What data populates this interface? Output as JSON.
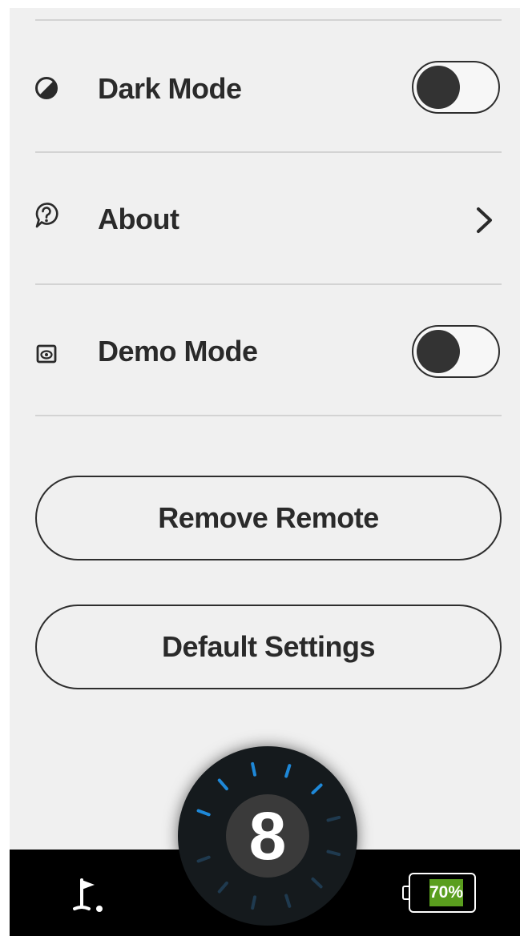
{
  "settings": {
    "rows": [
      {
        "label": "Dark Mode",
        "icon": "contrast-icon",
        "control": "toggle",
        "on": false
      },
      {
        "label": "About",
        "icon": "question-bubble-icon",
        "control": "chevron"
      },
      {
        "label": "Demo Mode",
        "icon": "eye-card-icon",
        "control": "toggle",
        "on": false
      }
    ],
    "buttons": {
      "remove_remote": "Remove Remote",
      "default_settings": "Default Settings"
    }
  },
  "dial": {
    "value": "8",
    "icon": "speed-dial-icon",
    "active_color": "#1e88d8",
    "inactive_color": "#1f3a4f"
  },
  "bottom_bar": {
    "left_icon": "golf-flag-icon",
    "battery": {
      "label": "70%",
      "level": 0.7,
      "fill_color": "#5a9e1e",
      "icon": "battery-icon"
    }
  }
}
